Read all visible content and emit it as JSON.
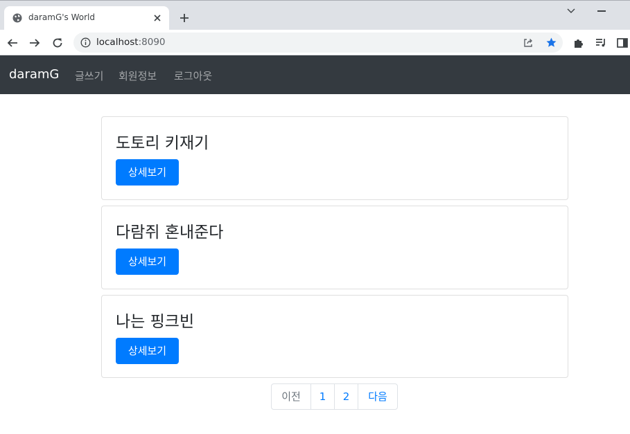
{
  "browser": {
    "tab_title": "daramG's World",
    "url_host": "localhost",
    "url_port": ":8090"
  },
  "navbar": {
    "brand": "daramG",
    "links": [
      "글쓰기",
      "회원정보",
      "로그아웃"
    ]
  },
  "posts": [
    {
      "title": "도토리 키재기",
      "button": "상세보기"
    },
    {
      "title": "다람쥐 혼내준다",
      "button": "상세보기"
    },
    {
      "title": "나는 핑크빈",
      "button": "상세보기"
    }
  ],
  "pagination": {
    "prev": "이전",
    "pages": [
      "1",
      "2"
    ],
    "next": "다음"
  },
  "colors": {
    "navbar_bg": "#343a40",
    "primary": "#007bff",
    "star": "#1a73e8"
  }
}
